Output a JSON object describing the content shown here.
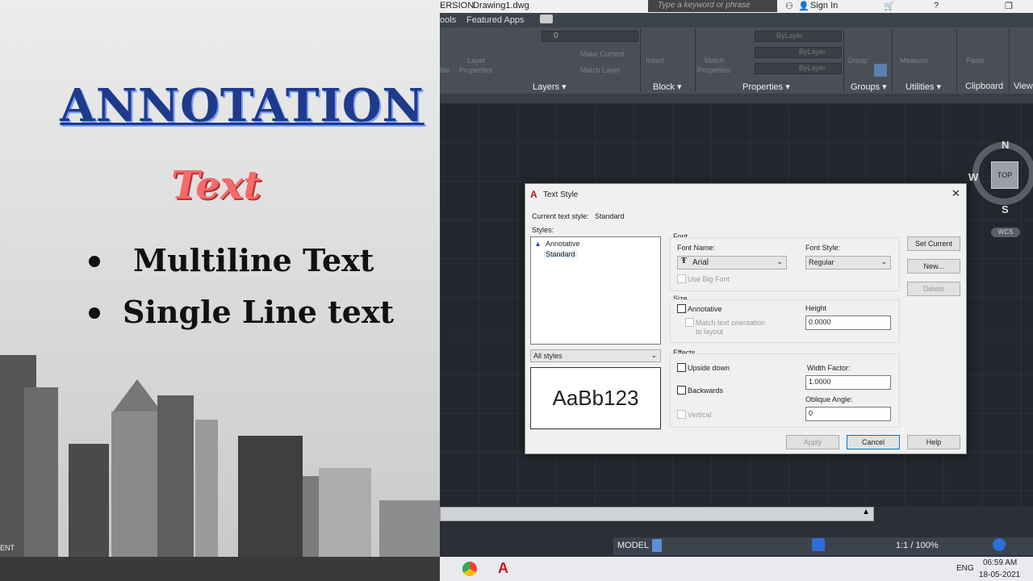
{
  "slide": {
    "title": "ANNOTATION",
    "subtitle": "Text",
    "bullets": [
      "Multiline Text",
      "Single Line text"
    ],
    "corner_text": "ENT"
  },
  "app": {
    "title_version": "ERSION",
    "file_name": "Drawing1.dwg",
    "search_placeholder": "Type a keyword or phrase",
    "sign_in": "Sign In",
    "tabs": [
      "ools",
      "Featured Apps"
    ],
    "ribbon": {
      "layer_value": "0",
      "panels": [
        "Layers ▾",
        "Block ▾",
        "Properties ▾",
        "Groups ▾",
        "Utilities ▾",
        "Clipboard",
        "View"
      ],
      "dim_labels": [
        "Layer",
        "Properties",
        "ble",
        "Make Current",
        "Match Layer",
        "Insert",
        "Match",
        "Properties",
        "Group",
        "Measure",
        "Paste"
      ],
      "bylayer": [
        "ByLayer",
        "ByLayer",
        "ByLayer"
      ]
    },
    "viewcube": {
      "n": "N",
      "s": "S",
      "w": "W",
      "top": "TOP",
      "wcs": "WCS"
    },
    "statusbar": {
      "model": "MODEL",
      "scale": "1:1 / 100%"
    },
    "taskbar": {
      "lang": "ENG",
      "time": "06:59 AM",
      "date": "18-05-2021"
    }
  },
  "dialog": {
    "title": "Text Style",
    "current_style_label": "Current text style:",
    "current_style_value": "Standard",
    "styles_label": "Styles:",
    "styles": [
      "Annotative",
      "Standard"
    ],
    "filter": "All styles",
    "preview": "AaBb123",
    "font": {
      "group": "Font",
      "name_label": "Font Name:",
      "name_value": "Arial",
      "style_label": "Font Style:",
      "style_value": "Regular",
      "bigfont": "Use Big Font"
    },
    "size": {
      "group": "Size",
      "annotative": "Annotative",
      "match": "Match text orientation",
      "match2": "to layout",
      "height_label": "Height",
      "height_value": "0.0000"
    },
    "effects": {
      "group": "Effects",
      "upside": "Upside down",
      "backwards": "Backwards",
      "vertical": "Vertical",
      "width_label": "Width Factor:",
      "width_value": "1.0000",
      "oblique_label": "Oblique Angle:",
      "oblique_value": "0"
    },
    "buttons": {
      "set_current": "Set Current",
      "new": "New...",
      "delete": "Delete",
      "apply": "Apply",
      "cancel": "Cancel",
      "help": "Help"
    }
  }
}
